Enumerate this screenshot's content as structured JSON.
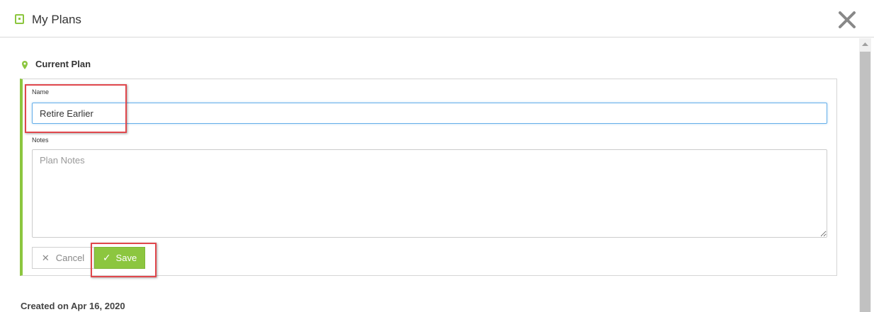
{
  "header": {
    "title": "My Plans",
    "icon": "plan-icon",
    "close_icon": "close-icon",
    "accent": "#8cc63f"
  },
  "section": {
    "title": "Current Plan",
    "icon": "map-pin-icon"
  },
  "form": {
    "name_label": "Name",
    "name_value": "Retire Earlier",
    "notes_label": "Notes",
    "notes_placeholder": "Plan Notes",
    "notes_value": "",
    "cancel_label": "Cancel",
    "save_label": "Save"
  },
  "footer": {
    "created_text": "Created on Apr 16, 2020"
  },
  "colors": {
    "accent_green": "#8cc63f",
    "highlight_red": "#e0474c",
    "focus_blue": "#66afe9"
  }
}
